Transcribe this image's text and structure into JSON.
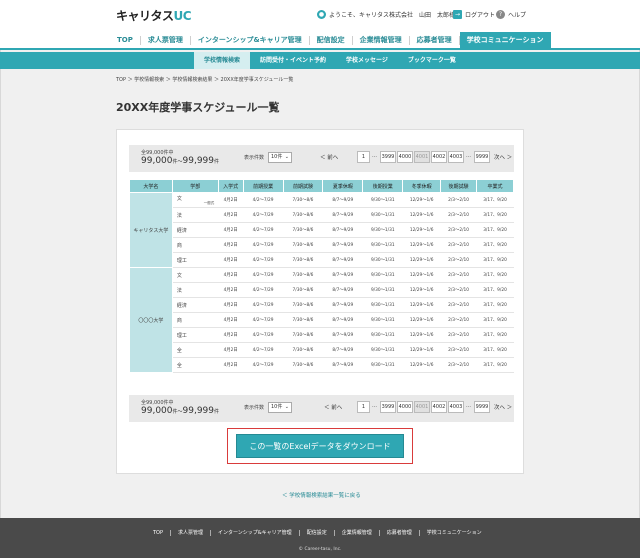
{
  "header": {
    "logo_main": "キャリタス",
    "logo_accent": "UC",
    "welcome": "ようこそ、キャリタス株式会社　山田　太郎様",
    "logout": "ログアウト",
    "help": "ヘルプ"
  },
  "gnav": [
    "TOP",
    "求人票管理",
    "インターンシップ&キャリア管理",
    "配信設定",
    "企業情報管理",
    "応募者管理",
    "学校コミュニケーション"
  ],
  "snav": [
    "学校情報検索",
    "訪問受付・イベント予約",
    "学校メッセージ",
    "ブックマーク一覧"
  ],
  "breadcrumb": "TOP ＞ 学校情報検索 ＞ 学校情報検索結果 ＞ 20XX年度学事スケジュール一覧",
  "page_title": "20XX年度学事スケジュール一覧",
  "pager": {
    "total": "全99,000件中",
    "range_start": "99,000",
    "range_sep": "件～",
    "range_end": "99,999",
    "range_unit": "件",
    "display_label": "表示件数",
    "display_value": "10件",
    "prev": "＜ 前へ",
    "next": "次へ ＞",
    "pages": [
      "1",
      "…",
      "3999",
      "4000",
      "4001",
      "4002",
      "4003",
      "…",
      "9999"
    ]
  },
  "table": {
    "headers": [
      "大学名",
      "学部",
      "入学式",
      "前期授業",
      "前期試験",
      "夏季休暇",
      "後期授業",
      "冬季休暇",
      "後期試験",
      "卒業式"
    ],
    "groups": [
      {
        "university": "キャリタス大学",
        "rows": [
          {
            "faculty": "文",
            "tag": "一般式",
            "cells": [
              "4月2日",
              "4/2〜7/29",
              "7/30〜8/6",
              "8/7〜9/29",
              "9/30〜1/31",
              "12/29〜1/6",
              "2/3〜2/10",
              "3/17、9/20"
            ]
          },
          {
            "faculty": "法",
            "tag": "",
            "cells": [
              "4月2日",
              "4/2〜7/29",
              "7/30〜8/6",
              "8/7〜9/29",
              "9/30〜1/31",
              "12/29〜1/6",
              "2/3〜2/10",
              "3/17、9/20"
            ]
          },
          {
            "faculty": "経済",
            "tag": "",
            "cells": [
              "4月2日",
              "4/2〜7/29",
              "7/30〜8/6",
              "8/7〜9/29",
              "9/30〜1/31",
              "12/29〜1/6",
              "2/3〜2/10",
              "3/17、9/20"
            ]
          },
          {
            "faculty": "商",
            "tag": "",
            "cells": [
              "4月2日",
              "4/2〜7/29",
              "7/30〜8/6",
              "8/7〜9/29",
              "9/30〜1/31",
              "12/29〜1/6",
              "2/3〜2/10",
              "3/17、9/20"
            ]
          },
          {
            "faculty": "理工",
            "tag": "",
            "cells": [
              "4月2日",
              "4/2〜7/29",
              "7/30〜8/6",
              "8/7〜9/29",
              "9/30〜1/31",
              "12/29〜1/6",
              "2/3〜2/10",
              "3/17、9/20"
            ]
          }
        ]
      },
      {
        "university": "〇〇〇大学",
        "rows": [
          {
            "faculty": "文",
            "tag": "",
            "cells": [
              "4月2日",
              "4/2〜7/29",
              "7/30〜8/6",
              "8/7〜9/29",
              "9/30〜1/31",
              "12/29〜1/6",
              "2/3〜2/10",
              "3/17、9/20"
            ]
          },
          {
            "faculty": "法",
            "tag": "",
            "cells": [
              "4月2日",
              "4/2〜7/29",
              "7/30〜8/6",
              "8/7〜9/29",
              "9/30〜1/31",
              "12/29〜1/6",
              "2/3〜2/10",
              "3/17、9/20"
            ]
          },
          {
            "faculty": "経済",
            "tag": "",
            "cells": [
              "4月2日",
              "4/2〜7/29",
              "7/30〜8/6",
              "8/7〜9/29",
              "9/30〜1/31",
              "12/29〜1/6",
              "2/3〜2/10",
              "3/17、9/20"
            ]
          },
          {
            "faculty": "商",
            "tag": "",
            "cells": [
              "4月2日",
              "4/2〜7/29",
              "7/30〜8/6",
              "8/7〜9/29",
              "9/30〜1/31",
              "12/29〜1/6",
              "2/3〜2/10",
              "3/17、9/20"
            ]
          },
          {
            "faculty": "理工",
            "tag": "",
            "cells": [
              "4月2日",
              "4/2〜7/29",
              "7/30〜8/6",
              "8/7〜9/29",
              "9/30〜1/31",
              "12/29〜1/6",
              "2/3〜2/10",
              "3/17、9/20"
            ]
          },
          {
            "faculty": "全",
            "tag": "",
            "cells": [
              "4月2日",
              "4/2〜7/29",
              "7/30〜8/6",
              "8/7〜9/29",
              "9/30〜1/31",
              "12/29〜1/6",
              "2/3〜2/10",
              "3/17、9/20"
            ]
          },
          {
            "faculty": "全",
            "tag": "",
            "cells": [
              "4月2日",
              "4/2〜7/29",
              "7/30〜8/6",
              "8/7〜9/29",
              "9/30〜1/31",
              "12/29〜1/6",
              "2/3〜2/10",
              "3/17、9/20"
            ]
          }
        ]
      }
    ]
  },
  "download_label": "この一覧のExcelデータをダウンロード",
  "back_link": "＜ 学校情報検索結果一覧に戻る",
  "footer": {
    "links": [
      "TOP",
      "求人票管理",
      "インターンシップ&キャリア管理",
      "配信設定",
      "企業情報管理",
      "応募者管理",
      "学校コミュニケーション"
    ],
    "copyright": "© Career-tasu, Inc."
  },
  "colors": {
    "accent": "#2fa7b3",
    "highlight": "#d93b3b",
    "footer": "#4a4a4a"
  }
}
